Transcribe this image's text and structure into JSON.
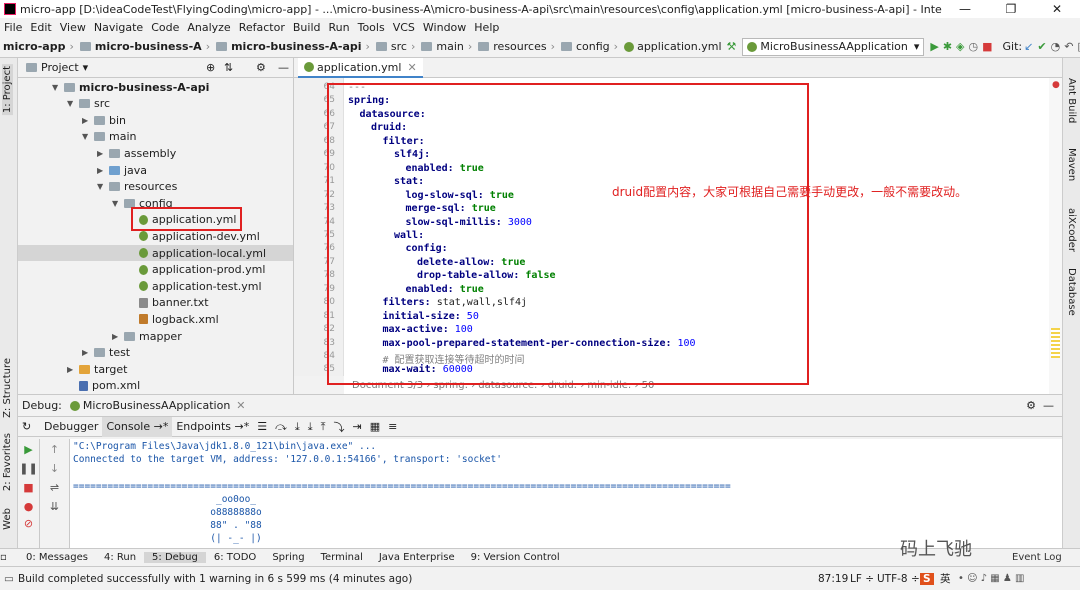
{
  "window": {
    "title": "micro-app [D:\\ideaCodeTest\\FlyingCoding\\micro-app] - ...\\micro-business-A\\micro-business-A-api\\src\\main\\resources\\config\\application.yml [micro-business-A-api] - IntelliJ IDEA",
    "minimize": "—",
    "maximize": "❐",
    "close": "✕"
  },
  "menu": [
    "File",
    "Edit",
    "View",
    "Navigate",
    "Code",
    "Analyze",
    "Refactor",
    "Build",
    "Run",
    "Tools",
    "VCS",
    "Window",
    "Help"
  ],
  "breadcrumbs": [
    "micro-app",
    "micro-business-A",
    "micro-business-A-api",
    "src",
    "main",
    "resources",
    "config",
    "application.yml"
  ],
  "toolbar": {
    "run_config": "MicroBusinessAApplication",
    "git_label": "Git:"
  },
  "left_stripe": {
    "project": "1: Project",
    "structure": "Z: Structure",
    "favorites": "2: Favorites",
    "web": "Web"
  },
  "right_stripe": [
    "Ant Build",
    "Maven",
    "aiXcoder",
    "Database"
  ],
  "project_panel": {
    "header": "Project",
    "tree": [
      {
        "label": "micro-business-A-api",
        "level": 0,
        "arrow": "▼",
        "kind": "module",
        "bold": true
      },
      {
        "label": "src",
        "level": 1,
        "arrow": "▼",
        "kind": "folder"
      },
      {
        "label": "bin",
        "level": 2,
        "arrow": "▶",
        "kind": "folder"
      },
      {
        "label": "main",
        "level": 2,
        "arrow": "▼",
        "kind": "folder"
      },
      {
        "label": "assembly",
        "level": 3,
        "arrow": "▶",
        "kind": "folder"
      },
      {
        "label": "java",
        "level": 3,
        "arrow": "▶",
        "kind": "src"
      },
      {
        "label": "resources",
        "level": 3,
        "arrow": "▼",
        "kind": "folder"
      },
      {
        "label": "config",
        "level": 4,
        "arrow": "▼",
        "kind": "folder"
      },
      {
        "label": "application.yml",
        "level": 5,
        "arrow": "",
        "kind": "yml",
        "boxed": true
      },
      {
        "label": "application-dev.yml",
        "level": 5,
        "arrow": "",
        "kind": "yml"
      },
      {
        "label": "application-local.yml",
        "level": 5,
        "arrow": "",
        "kind": "yml",
        "selected": true
      },
      {
        "label": "application-prod.yml",
        "level": 5,
        "arrow": "",
        "kind": "yml"
      },
      {
        "label": "application-test.yml",
        "level": 5,
        "arrow": "",
        "kind": "yml"
      },
      {
        "label": "banner.txt",
        "level": 5,
        "arrow": "",
        "kind": "txt"
      },
      {
        "label": "logback.xml",
        "level": 5,
        "arrow": "",
        "kind": "xml"
      },
      {
        "label": "mapper",
        "level": 4,
        "arrow": "▶",
        "kind": "folder"
      },
      {
        "label": "test",
        "level": 2,
        "arrow": "▶",
        "kind": "folder"
      },
      {
        "label": "target",
        "level": 1,
        "arrow": "▶",
        "kind": "target"
      },
      {
        "label": "pom.xml",
        "level": 1,
        "arrow": "",
        "kind": "pom"
      }
    ]
  },
  "editor": {
    "tab": "application.yml",
    "lines": [
      {
        "no": "64",
        "text": "---",
        "cls": "c"
      },
      {
        "no": "65",
        "indent": 0,
        "key": "spring:"
      },
      {
        "no": "66",
        "indent": 1,
        "key": "datasource:"
      },
      {
        "no": "67",
        "indent": 2,
        "key": "druid:"
      },
      {
        "no": "68",
        "indent": 3,
        "key": "filter:"
      },
      {
        "no": "69",
        "indent": 4,
        "key": "slf4j:"
      },
      {
        "no": "70",
        "indent": 5,
        "key": "enabled:",
        "val": " true",
        "vcls": "v"
      },
      {
        "no": "71",
        "indent": 4,
        "key": "stat:"
      },
      {
        "no": "72",
        "indent": 5,
        "key": "log-slow-sql:",
        "val": " true",
        "vcls": "v"
      },
      {
        "no": "73",
        "indent": 5,
        "key": "merge-sql:",
        "val": " true",
        "vcls": "v"
      },
      {
        "no": "74",
        "indent": 5,
        "key": "slow-sql-millis:",
        "val": " 3000",
        "vcls": "n"
      },
      {
        "no": "75",
        "indent": 4,
        "key": "wall:"
      },
      {
        "no": "76",
        "indent": 5,
        "key": "config:"
      },
      {
        "no": "77",
        "indent": 6,
        "key": "delete-allow:",
        "val": " true",
        "vcls": "v"
      },
      {
        "no": "78",
        "indent": 6,
        "key": "drop-table-allow:",
        "val": " false",
        "vcls": "v"
      },
      {
        "no": "79",
        "indent": 5,
        "key": "enabled:",
        "val": " true",
        "vcls": "v"
      },
      {
        "no": "80",
        "indent": 3,
        "key": "filters:",
        "val": " stat,wall,slf4j",
        "vcls": ""
      },
      {
        "no": "81",
        "indent": 3,
        "key": "initial-size:",
        "val": " 50",
        "vcls": "n"
      },
      {
        "no": "82",
        "indent": 3,
        "key": "max-active:",
        "val": " 100",
        "vcls": "n"
      },
      {
        "no": "83",
        "indent": 3,
        "key": "max-pool-prepared-statement-per-connection-size:",
        "val": " 100",
        "vcls": "n"
      },
      {
        "no": "84",
        "indent": 3,
        "comment": "# 配置获取连接等待超时的时间"
      },
      {
        "no": "85",
        "indent": 3,
        "key": "max-wait:",
        "val": " 60000",
        "vcls": "n"
      }
    ],
    "annotation": "druid配置内容，大家可根据自己需要手动更改，一般不需要改动。",
    "breadcrumb": "Document 3/3  ›  spring:  ›  datasource:  ›  druid:  ›  min-idle:  ›  50"
  },
  "debug": {
    "label": "Debug:",
    "session": "MicroBusinessAApplication",
    "tabs": [
      "Debugger",
      "Console →*",
      "Endpoints →*"
    ],
    "console_lines": [
      "\"C:\\Program Files\\Java\\jdk1.8.0_121\\bin\\java.exe\" ...",
      "Connected to the target VM, address: '127.0.0.1:54166', transport: 'socket'",
      "",
      "===================================================================================================================",
      "                         _oo0oo_",
      "                        o8888888o",
      "                        88\" . \"88",
      "                        (| -_- |)"
    ]
  },
  "bottom_tabs": [
    "0: Messages",
    "4: Run",
    "5: Debug",
    "6: TODO",
    "Spring",
    "Terminal",
    "Java Enterprise",
    "9: Version Control"
  ],
  "status": {
    "message": "Build completed successfully with 1 warning in 6 s 599 ms (4 minutes ago)",
    "position": "87:19",
    "line_sep": "LF ÷",
    "encoding": "UTF-8 ÷",
    "event_log": "Event Log",
    "watermark": "码上飞驰",
    "ime": "英"
  },
  "colors": {
    "accent": "#4083c9",
    "annotation_red": "#e02020",
    "yaml_key": "#000080",
    "yaml_value": "#008000",
    "yaml_number": "#0000ff",
    "run_green": "#3a9a3a",
    "stop_red": "#d53a3a"
  }
}
